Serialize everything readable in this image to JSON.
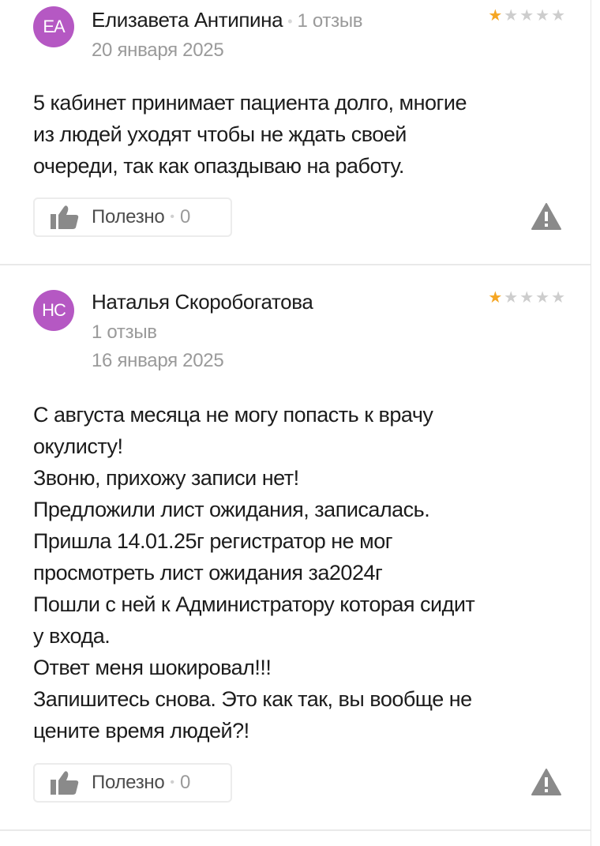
{
  "reviews": [
    {
      "avatar_initials": "ЕА",
      "author": "Елизавета Антипина",
      "review_count": "1 отзыв",
      "date": "20 января 2025",
      "rating": 1,
      "text": "5 кабинет принимает пациента долго, многие\nиз людей уходят чтобы не ждать своей\nочереди, так как опаздываю на работу.",
      "useful_label": "Полезно",
      "useful_count": "0"
    },
    {
      "avatar_initials": "НС",
      "author": "Наталья Скоробогатова",
      "review_count": "1 отзыв",
      "date": "16 января 2025",
      "rating": 1,
      "text": "С августа месяца не могу попасть к врачу\nокулисту!\nЗвоню, прихожу записи нет!\nПредложили лист ожидания, записалась.\nПришла 14.01.25г регистратор не мог\nпросмотреть лист ожидания за2024г\nПошли с ней к Администратору которая сидит\nу входа.\nОтвет меня шокировал!!!\nЗапишитесь снова. Это как так, вы вообще не\nцените время людей?!",
      "useful_label": "Полезно",
      "useful_count": "0"
    }
  ],
  "colors": {
    "avatar_bg": "#b558c3",
    "star_filled": "#f5a623",
    "star_empty": "#cdcdcd",
    "muted_text": "#9a9a9a"
  },
  "icons": {
    "like": "thumbs-up-icon",
    "report": "warning-triangle-icon",
    "star": "star-icon"
  }
}
